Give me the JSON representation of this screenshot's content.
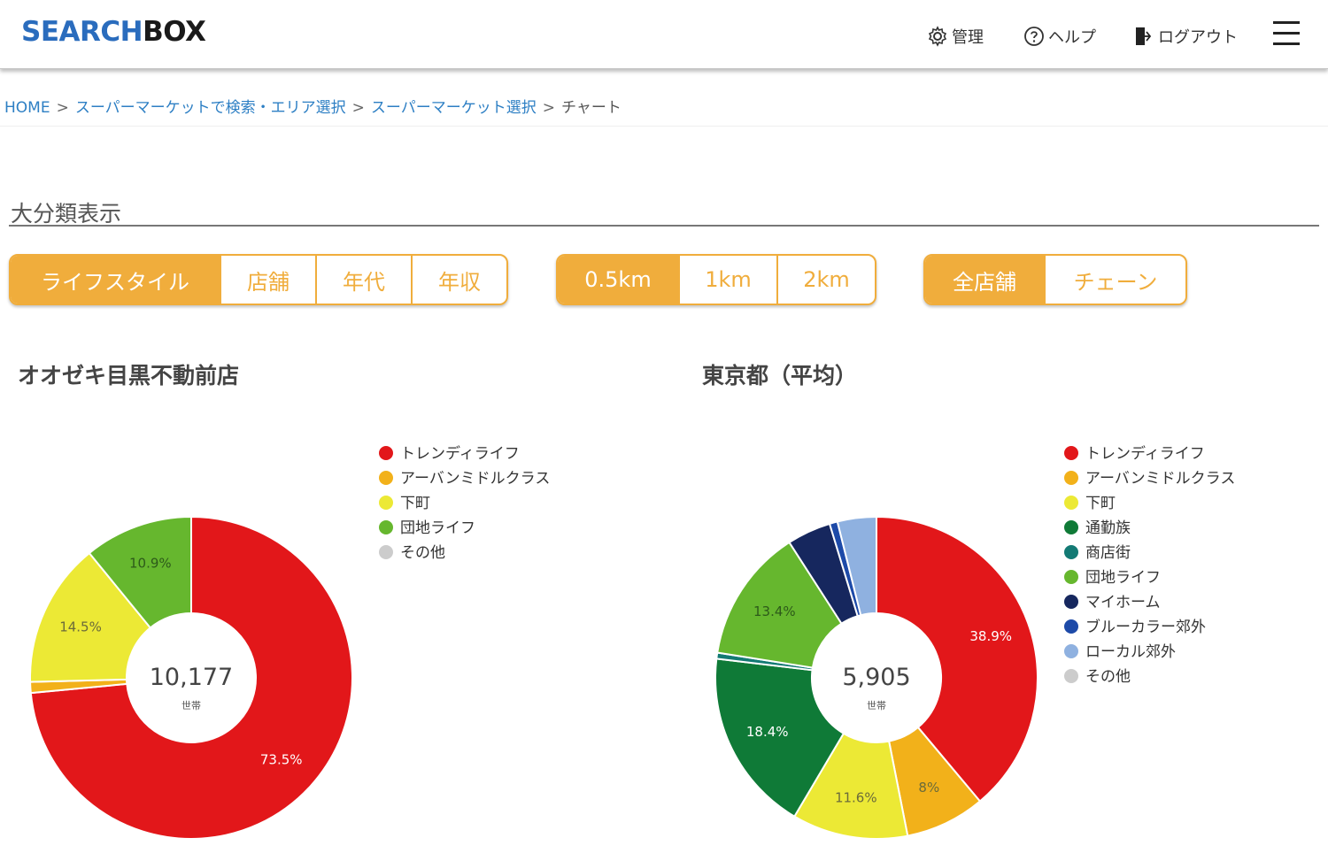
{
  "header": {
    "logo_part1": "SEARCH",
    "logo_part2": "BOX",
    "nav": [
      {
        "label": "管理",
        "icon": "gear-icon"
      },
      {
        "label": "ヘルプ",
        "icon": "help-circle-icon"
      },
      {
        "label": "ログアウト",
        "icon": "logout-icon"
      }
    ],
    "menu_icon": "hamburger-menu-icon"
  },
  "breadcrumb": {
    "items": [
      "HOME",
      "スーパーマーケットで検索・エリア選択",
      "スーパーマーケット選択",
      "チャート"
    ],
    "separator": ">"
  },
  "section_title": "大分類表示",
  "filters": {
    "category": {
      "options": [
        "ライフスタイル",
        "店舗",
        "年代",
        "年収"
      ],
      "selected": "ライフスタイル"
    },
    "distance": {
      "options": [
        "0.5km",
        "1km",
        "2km"
      ],
      "selected": "0.5km"
    },
    "scope": {
      "options": [
        "全店舗",
        "チェーン"
      ],
      "selected": "全店舗"
    }
  },
  "colors": {
    "accent": "#f0ad3c",
    "link": "#2d7fc4"
  },
  "chart_data": [
    {
      "type": "pie",
      "title": "オオゼキ目黒不動前店",
      "center_value": "10,177",
      "center_unit": "世帯",
      "legend_position": "right",
      "series": [
        {
          "name": "トレンディライフ",
          "value": 73.5,
          "label": "73.5%",
          "color": "#e2171a"
        },
        {
          "name": "アーバンミドルクラス",
          "value": 1.1,
          "label": "",
          "color": "#f2b11a"
        },
        {
          "name": "下町",
          "value": 14.5,
          "label": "14.5%",
          "color": "#ece935"
        },
        {
          "name": "団地ライフ",
          "value": 10.9,
          "label": "10.9%",
          "color": "#66b72e"
        },
        {
          "name": "その他",
          "value": 0,
          "label": "",
          "color": "#cccccc"
        }
      ]
    },
    {
      "type": "pie",
      "title": "東京都（平均）",
      "center_value": "5,905",
      "center_unit": "世帯",
      "legend_position": "right",
      "series": [
        {
          "name": "トレンディライフ",
          "value": 38.9,
          "label": "38.9%",
          "color": "#e2171a"
        },
        {
          "name": "アーバンミドルクラス",
          "value": 8,
          "label": "8%",
          "color": "#f2b11a"
        },
        {
          "name": "下町",
          "value": 11.6,
          "label": "11.6%",
          "color": "#ece935"
        },
        {
          "name": "通勤族",
          "value": 18.4,
          "label": "18.4%",
          "color": "#0f7a37"
        },
        {
          "name": "商店街",
          "value": 0.6,
          "label": "",
          "color": "#137a74"
        },
        {
          "name": "団地ライフ",
          "value": 13.4,
          "label": "13.4%",
          "color": "#66b72e"
        },
        {
          "name": "マイホーム",
          "value": 4.4,
          "label": "",
          "color": "#16275e"
        },
        {
          "name": "ブルーカラー郊外",
          "value": 0.8,
          "label": "",
          "color": "#1d4aa8"
        },
        {
          "name": "ローカル郊外",
          "value": 3.9,
          "label": "",
          "color": "#8fb1e0"
        },
        {
          "name": "その他",
          "value": 0,
          "label": "",
          "color": "#cccccc"
        }
      ]
    }
  ]
}
